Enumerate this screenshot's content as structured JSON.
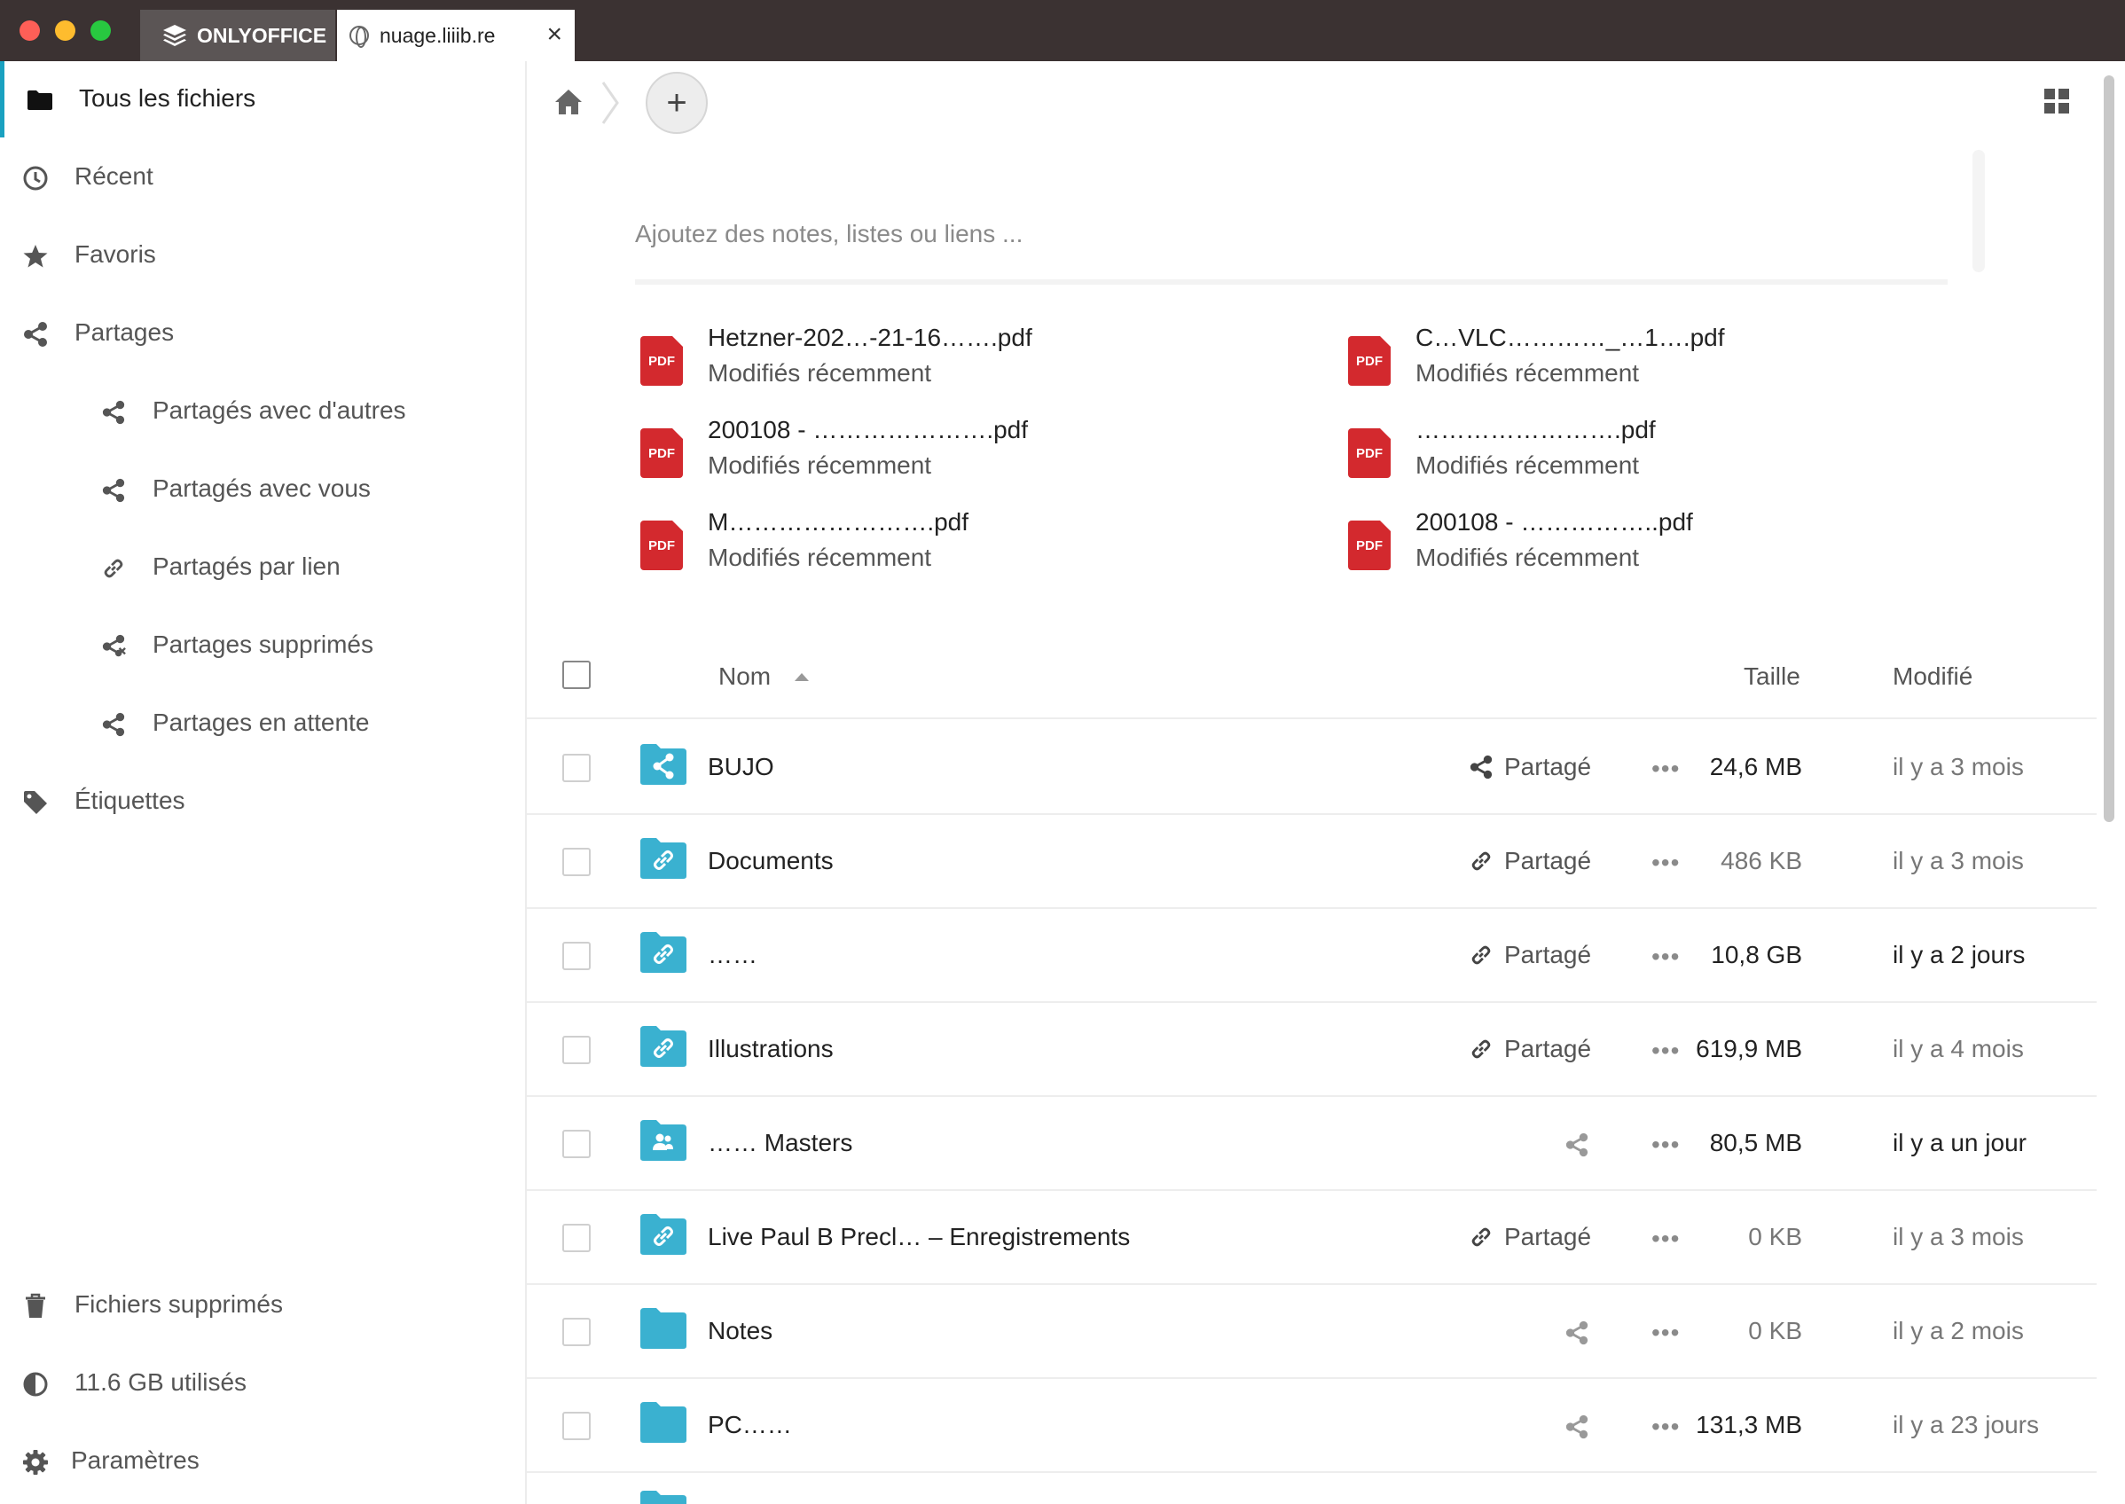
{
  "window": {
    "tabs": [
      {
        "label": "ONLYOFFICE"
      },
      {
        "label": "nuage.liiib.re",
        "close": "×"
      }
    ]
  },
  "sidebar": {
    "items": [
      {
        "label": "Tous les fichiers",
        "icon": "folder-icon"
      },
      {
        "label": "Récent",
        "icon": "clock-icon"
      },
      {
        "label": "Favoris",
        "icon": "star-icon"
      },
      {
        "label": "Partages",
        "icon": "share-icon"
      },
      {
        "label": "Partagés avec d'autres",
        "icon": "share-icon"
      },
      {
        "label": "Partagés avec vous",
        "icon": "share-icon"
      },
      {
        "label": "Partagés par lien",
        "icon": "link-icon"
      },
      {
        "label": "Partages supprimés",
        "icon": "share-deleted-icon"
      },
      {
        "label": "Partages en attente",
        "icon": "share-icon"
      },
      {
        "label": "Étiquettes",
        "icon": "tag-icon"
      }
    ],
    "bottom": [
      {
        "label": "Fichiers supprimés",
        "icon": "trash-icon"
      },
      {
        "label": "11.6 GB utilisés",
        "icon": "quota-icon"
      },
      {
        "label": "Paramètres",
        "icon": "gear-icon"
      }
    ]
  },
  "toolbar": {
    "add_label": "+"
  },
  "notes": {
    "placeholder": "Ajoutez des notes, listes ou liens ..."
  },
  "recent_files": {
    "subtitle": "Modifiés récemment",
    "pdf_badge": "PDF",
    "items": [
      {
        "name": "Hetzner-202…-21-16…….pdf"
      },
      {
        "name": "C…VLC…………_…1….pdf"
      },
      {
        "name": "200108 - ………………….pdf"
      },
      {
        "name": "…………………….pdf"
      },
      {
        "name": "M…………………….pdf"
      },
      {
        "name": "200108 - ……………..pdf"
      }
    ]
  },
  "file_list": {
    "headers": {
      "name": "Nom",
      "size": "Taille",
      "modified": "Modifié"
    },
    "more_label": "•••",
    "rows": [
      {
        "name": "BUJO",
        "share_label": "Partagé",
        "share_type": "share",
        "size": "24,6 MB",
        "modified": "il y a 3 mois",
        "folder_type": "shared"
      },
      {
        "name": "Documents",
        "share_label": "Partagé",
        "share_type": "link",
        "size": "486 KB",
        "modified": "il y a 3 mois",
        "folder_type": "link"
      },
      {
        "name": "……",
        "share_label": "Partagé",
        "share_type": "link",
        "size": "10,8 GB",
        "modified": "il y a 2 jours",
        "folder_type": "link"
      },
      {
        "name": "Illustrations",
        "share_label": "Partagé",
        "share_type": "link",
        "size": "619,9 MB",
        "modified": "il y a 4 mois",
        "folder_type": "link"
      },
      {
        "name": "…… Masters",
        "share_label": "",
        "share_type": "icon",
        "size": "80,5 MB",
        "modified": "il y a un jour",
        "folder_type": "group"
      },
      {
        "name": "Live Paul B Precl… – Enregistrements",
        "share_label": "Partagé",
        "share_type": "link",
        "size": "0 KB",
        "modified": "il y a 3 mois",
        "folder_type": "link"
      },
      {
        "name": "Notes",
        "share_label": "",
        "share_type": "icon",
        "size": "0 KB",
        "modified": "il y a 2 mois",
        "folder_type": "plain"
      },
      {
        "name": "PC……",
        "share_label": "",
        "share_type": "icon",
        "size": "131,3 MB",
        "modified": "il y a 23 jours",
        "folder_type": "plain"
      }
    ]
  },
  "colors": {
    "accent": "#1aa1c0",
    "folder": "#3ab1d0",
    "pdf": "#d3292e",
    "titlebar": "#3b3232"
  }
}
